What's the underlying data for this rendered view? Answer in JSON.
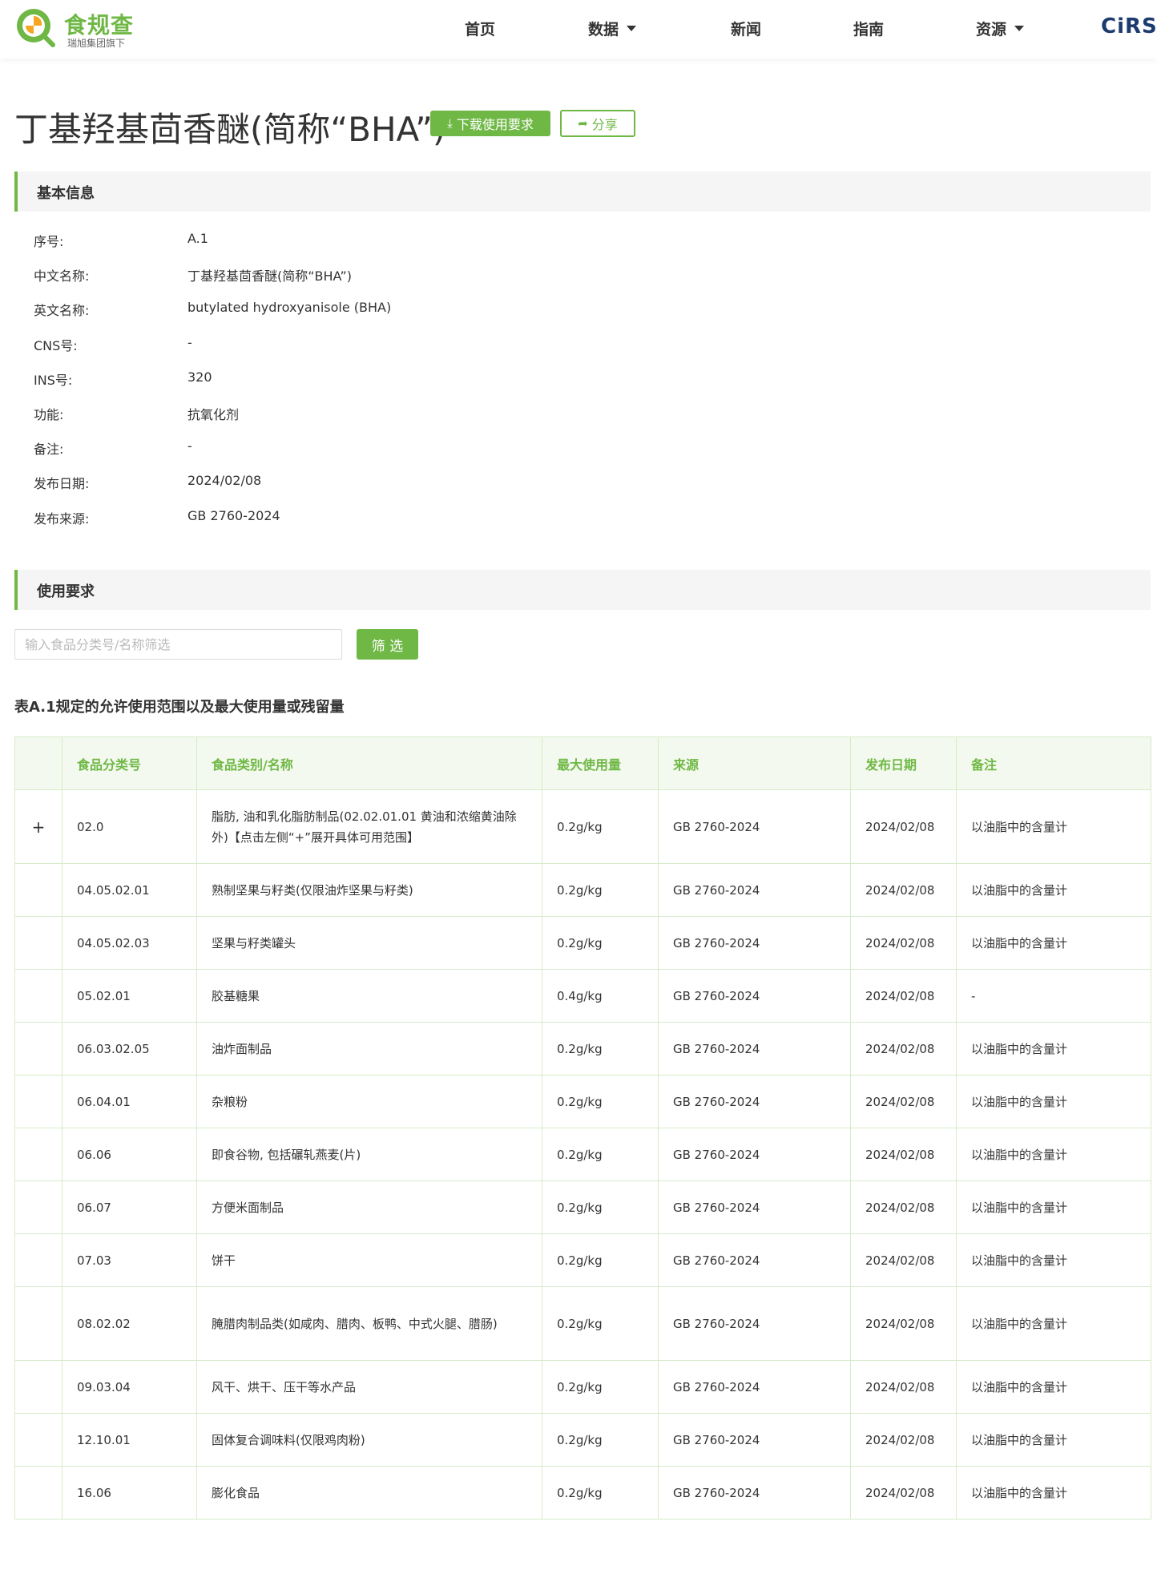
{
  "header": {
    "logo_name": "食规查",
    "logo_sub": "瑞旭集团旗下",
    "nav": [
      {
        "label": "首页",
        "dropdown": false
      },
      {
        "label": "数据",
        "dropdown": true
      },
      {
        "label": "新闻",
        "dropdown": false
      },
      {
        "label": "指南",
        "dropdown": false
      },
      {
        "label": "资源",
        "dropdown": true
      }
    ],
    "partner": "CiRS"
  },
  "title": "丁基羟基茴香醚(简称“BHA”)",
  "actions": {
    "download_label": "下载使用要求",
    "share_label": "分享"
  },
  "basic_info": {
    "heading": "基本信息",
    "rows": [
      {
        "label": "序号:",
        "value": "A.1"
      },
      {
        "label": "中文名称:",
        "value": "丁基羟基茴香醚(简称“BHA”)"
      },
      {
        "label": "英文名称:",
        "value": "butylated hydroxyanisole (BHA)"
      },
      {
        "label": "CNS号:",
        "value": "-"
      },
      {
        "label": "INS号:",
        "value": "320"
      },
      {
        "label": "功能:",
        "value": "抗氧化剂"
      },
      {
        "label": "备注:",
        "value": "-"
      },
      {
        "label": "发布日期:",
        "value": "2024/02/08"
      },
      {
        "label": "发布来源:",
        "value": "GB 2760-2024"
      }
    ]
  },
  "usage": {
    "heading": "使用要求",
    "filter_placeholder": "输入食品分类号/名称筛选",
    "filter_button": "筛 选",
    "table_caption": "表A.1规定的允许使用范围以及最大使用量或残留量",
    "columns": [
      "食品分类号",
      "食品类别/名称",
      "最大使用量",
      "来源",
      "发布日期",
      "备注"
    ],
    "expand_symbol": "+",
    "rows": [
      {
        "code": "02.0",
        "name": "脂肪, 油和乳化脂肪制品(02.02.01.01 黄油和浓缩黄油除外)【点击左侧“+”展开具体可用范围】",
        "max": "0.2g/kg",
        "source": "GB 2760-2024",
        "date": "2024/02/08",
        "note": "以油脂中的含量计",
        "expandable": true
      },
      {
        "code": "04.05.02.01",
        "name": "熟制坚果与籽类(仅限油炸坚果与籽类)",
        "max": "0.2g/kg",
        "source": "GB 2760-2024",
        "date": "2024/02/08",
        "note": "以油脂中的含量计"
      },
      {
        "code": "04.05.02.03",
        "name": "坚果与籽类罐头",
        "max": "0.2g/kg",
        "source": "GB 2760-2024",
        "date": "2024/02/08",
        "note": "以油脂中的含量计"
      },
      {
        "code": "05.02.01",
        "name": "胶基糖果",
        "max": "0.4g/kg",
        "source": "GB 2760-2024",
        "date": "2024/02/08",
        "note": "-"
      },
      {
        "code": "06.03.02.05",
        "name": "油炸面制品",
        "max": "0.2g/kg",
        "source": "GB 2760-2024",
        "date": "2024/02/08",
        "note": "以油脂中的含量计"
      },
      {
        "code": "06.04.01",
        "name": "杂粮粉",
        "max": "0.2g/kg",
        "source": "GB 2760-2024",
        "date": "2024/02/08",
        "note": "以油脂中的含量计"
      },
      {
        "code": "06.06",
        "name": "即食谷物, 包括碾轧燕麦(片)",
        "max": "0.2g/kg",
        "source": "GB 2760-2024",
        "date": "2024/02/08",
        "note": "以油脂中的含量计"
      },
      {
        "code": "06.07",
        "name": "方便米面制品",
        "max": "0.2g/kg",
        "source": "GB 2760-2024",
        "date": "2024/02/08",
        "note": "以油脂中的含量计"
      },
      {
        "code": "07.03",
        "name": "饼干",
        "max": "0.2g/kg",
        "source": "GB 2760-2024",
        "date": "2024/02/08",
        "note": "以油脂中的含量计"
      },
      {
        "code": "08.02.02",
        "name": "腌腊肉制品类(如咸肉、腊肉、板鸭、中式火腿、腊肠)",
        "max": "0.2g/kg",
        "source": "GB 2760-2024",
        "date": "2024/02/08",
        "note": "以油脂中的含量计"
      },
      {
        "code": "09.03.04",
        "name": "风干、烘干、压干等水产品",
        "max": "0.2g/kg",
        "source": "GB 2760-2024",
        "date": "2024/02/08",
        "note": "以油脂中的含量计"
      },
      {
        "code": "12.10.01",
        "name": "固体复合调味料(仅限鸡肉粉)",
        "max": "0.2g/kg",
        "source": "GB 2760-2024",
        "date": "2024/02/08",
        "note": "以油脂中的含量计"
      },
      {
        "code": "16.06",
        "name": "膨化食品",
        "max": "0.2g/kg",
        "source": "GB 2760-2024",
        "date": "2024/02/08",
        "note": "以油脂中的含量计"
      }
    ]
  },
  "colors": {
    "accent": "#6fb845",
    "header_bg": "#f3f9ee",
    "border": "#d6ebc9",
    "partner": "#1c3a6e"
  }
}
